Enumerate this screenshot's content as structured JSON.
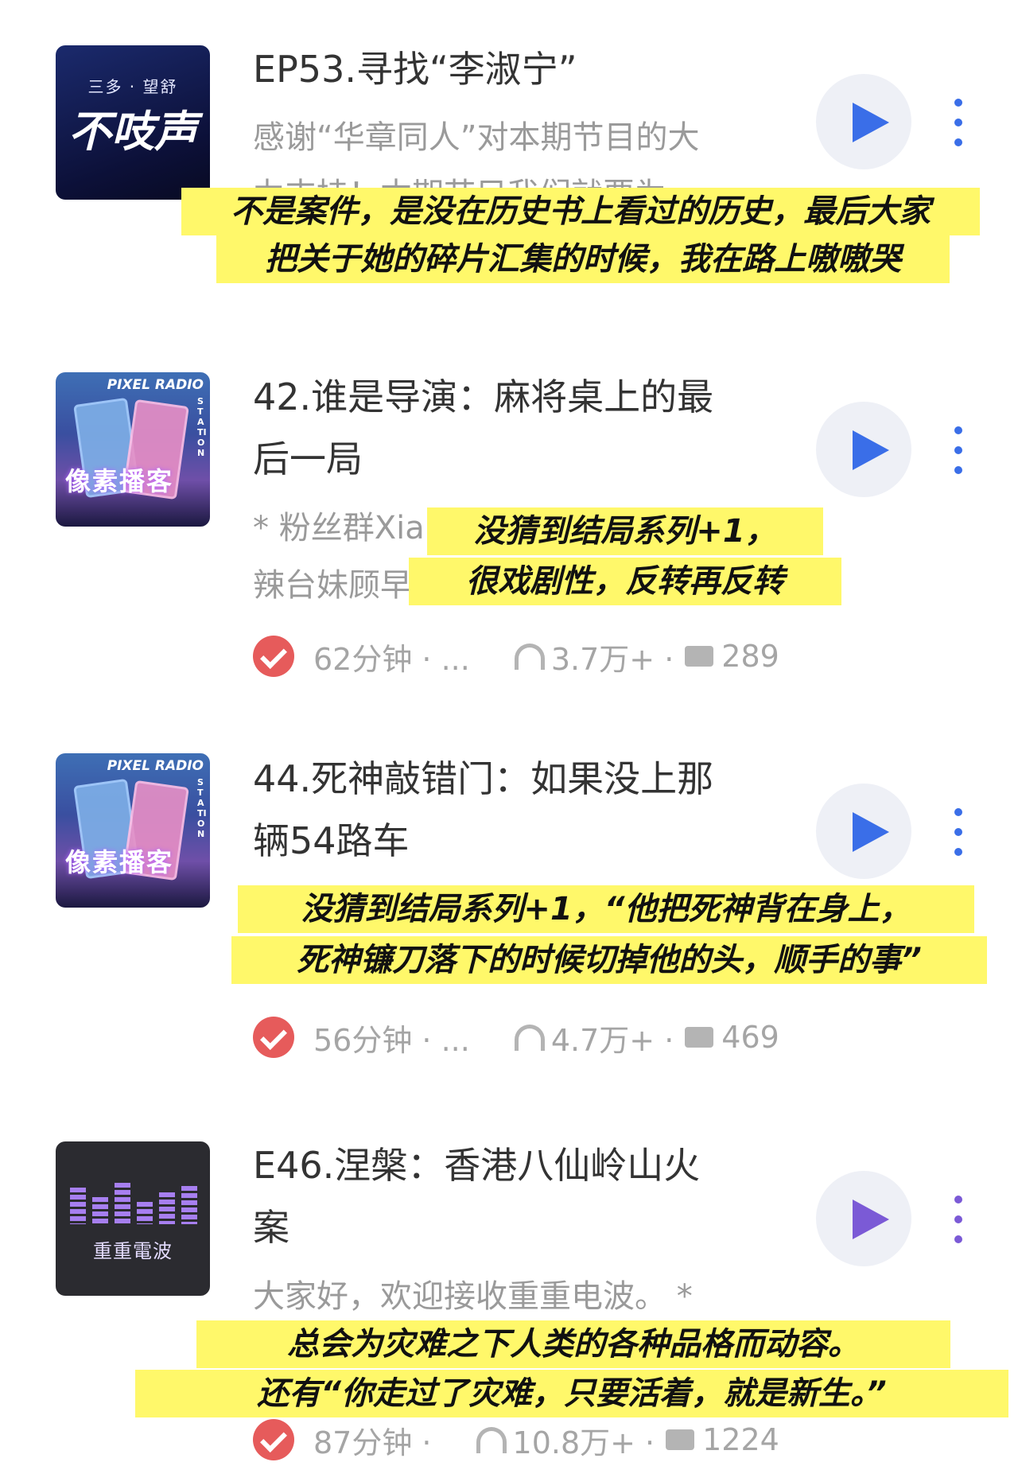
{
  "episodes": [
    {
      "cover": {
        "line1": "三多 · 望舒",
        "line2": "不吱声"
      },
      "title_lines": [
        "EP53.寻找“李淑宁”"
      ],
      "desc_lines": [
        "感谢“华章同人”对本期节目的大",
        "力支持！本期节目我们就要为"
      ],
      "annotation_lines": [
        "不是案件，是没在历史书上看过的历史，最后大家",
        "把关于她的碎片汇集的时候，我在路上嗷嗷哭"
      ],
      "play_color": "#3a6ee8"
    },
    {
      "cover": {
        "header": "PIXEL RADIO",
        "side": "STATION",
        "label": "像素播客"
      },
      "title_lines": [
        "42.谁是导演：麻将桌上的最",
        "后一局"
      ],
      "desc_lines": [
        "* 粉丝群Xia",
        "辣台妹顾早"
      ],
      "annotation_lines": [
        "没猜到结局系列+1，",
        "很戏剧性，反转再反转"
      ],
      "meta": {
        "duration": "62分钟 · ...",
        "plays": "3.7万+ ·",
        "comments": "289"
      },
      "play_color": "#3a6ee8"
    },
    {
      "cover": {
        "header": "PIXEL RADIO",
        "side": "STATION",
        "label": "像素播客"
      },
      "title_lines": [
        "44.死神敲错门：如果没上那",
        "辆54路车"
      ],
      "annotation_lines": [
        "没猜到结局系列+1，“他把死神背在身上，",
        "死神镰刀落下的时候切掉他的头，顺手的事”"
      ],
      "meta": {
        "duration": "56分钟 · ...",
        "plays": "4.7万+ ·",
        "comments": "469"
      },
      "play_color": "#3a6ee8"
    },
    {
      "cover": {
        "label": "重重電波"
      },
      "title_lines": [
        "E46.涅槃：香港八仙岭山火",
        "案"
      ],
      "desc_lines": [
        "大家好，欢迎接收重重电波。 *"
      ],
      "annotation_lines": [
        "总会为灾难之下人类的各种品格而动容。",
        "还有“你走过了灾难，只要活着，就是新生。”"
      ],
      "meta": {
        "duration": "87分钟 ·",
        "plays": "10.8万+ ·",
        "comments": "1224"
      },
      "play_color": "#7b5ad6"
    }
  ]
}
